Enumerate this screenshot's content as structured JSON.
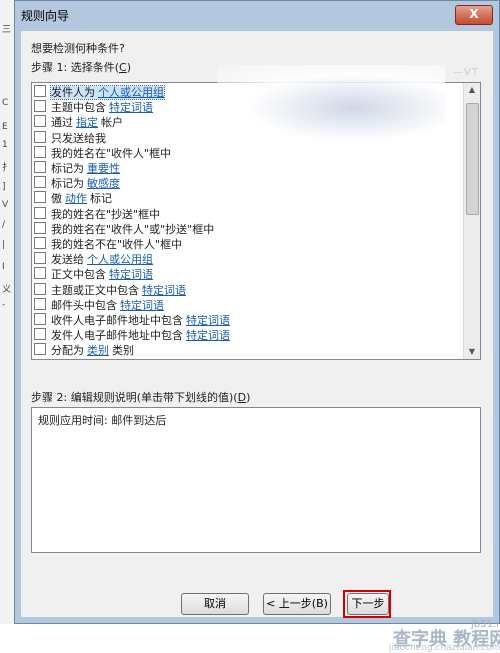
{
  "window": {
    "title": "规则向导",
    "close_glyph": "X"
  },
  "step1": {
    "question": "想要检测何种条件?",
    "label": "步骤 1: 选择条件(",
    "accel": "C",
    "label_end": ")"
  },
  "conditions": [
    {
      "text": "发件人为",
      "link": "个人或公用组",
      "suffix": ""
    },
    {
      "text": "主题中包含",
      "link": "特定词语",
      "suffix": ""
    },
    {
      "text": "通过",
      "link": "指定",
      "suffix": "帐户"
    },
    {
      "text": "只发送给我",
      "link": "",
      "suffix": ""
    },
    {
      "text": "我的姓名在\"收件人\"框中",
      "link": "",
      "suffix": ""
    },
    {
      "text": "标记为",
      "link": "重要性",
      "suffix": ""
    },
    {
      "text": "标记为",
      "link": "敏感度",
      "suffix": ""
    },
    {
      "text": "傲",
      "link": "动作",
      "suffix": "标记"
    },
    {
      "text": "我的姓名在\"抄送\"框中",
      "link": "",
      "suffix": ""
    },
    {
      "text": "我的姓名在\"收件人\"或\"抄送\"框中",
      "link": "",
      "suffix": ""
    },
    {
      "text": "我的姓名不在\"收件人\"框中",
      "link": "",
      "suffix": ""
    },
    {
      "text": "发送给",
      "link": "个人或公用组",
      "suffix": ""
    },
    {
      "text": "正文中包含",
      "link": "特定词语",
      "suffix": ""
    },
    {
      "text": "主题或正文中包含",
      "link": "特定词语",
      "suffix": ""
    },
    {
      "text": "邮件头中包含",
      "link": "特定词语",
      "suffix": ""
    },
    {
      "text": "收件人电子邮件地址中包含",
      "link": "特定词语",
      "suffix": ""
    },
    {
      "text": "发件人电子邮件地址中包含",
      "link": "特定词语",
      "suffix": ""
    },
    {
      "text": "分配为",
      "link": "类别",
      "suffix": "类别"
    }
  ],
  "step2": {
    "label": "步骤 2: 编辑规则说明(单击带下划线的值)(",
    "accel": "D",
    "label_end": ")",
    "description": "规则应用时间: 邮件到达后"
  },
  "buttons": {
    "cancel": "取消",
    "back": "< 上一步(B)",
    "next": "下一步"
  },
  "scrollbar": {
    "up_glyph": "▲",
    "down_glyph": "▼"
  },
  "watermark": {
    "top_right": "—VT",
    "main": "查字典 教程网",
    "url": "jiaocheng.chazidian.com",
    "site": "jb51.net"
  },
  "left_strip_chars": [
    "三",
    "C",
    "E",
    "1",
    "扌",
    "]",
    "V",
    "/",
    "|",
    "I",
    "义",
    "-"
  ]
}
